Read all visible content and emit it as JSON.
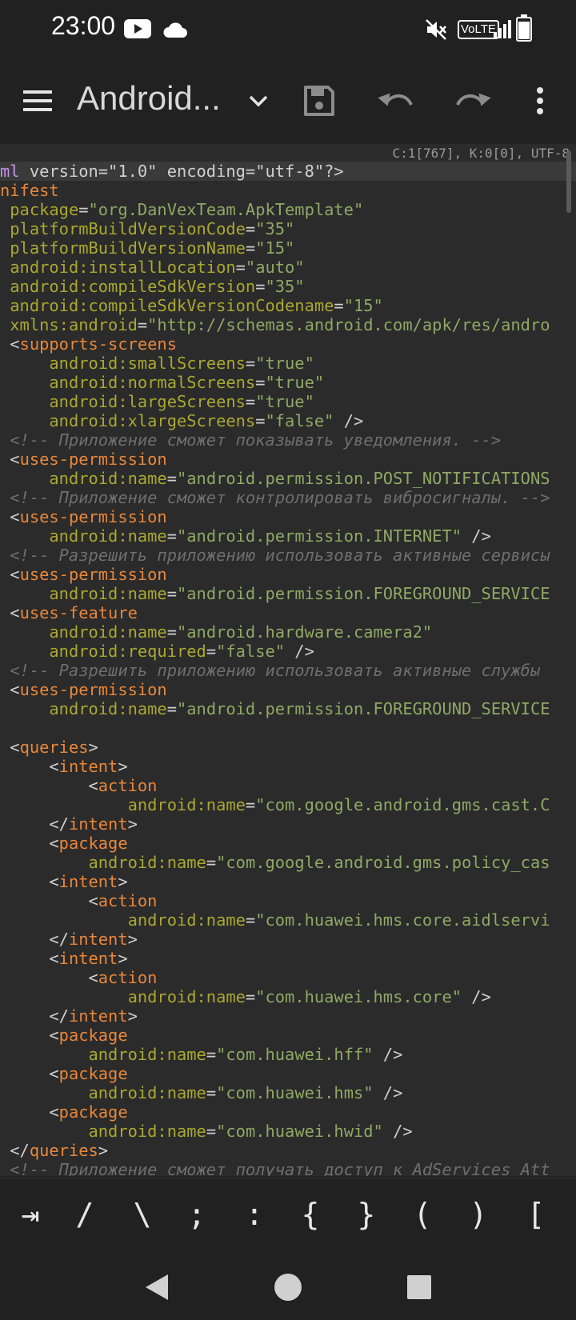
{
  "status_bar": {
    "time": "23:00",
    "icons": [
      "youtube-icon",
      "cloud-icon",
      "mute-icon",
      "volte-badge",
      "signal-icon",
      "battery-icon"
    ],
    "volte_label": "VoLTE"
  },
  "toolbar": {
    "title": "Android...",
    "icons": [
      "menu-icon",
      "dropdown-chevron-icon",
      "save-icon",
      "undo-icon",
      "redo-icon",
      "more-vert-icon"
    ]
  },
  "editor": {
    "cursor_info": "C:1[767], K:0[0], UTF-8",
    "lines": [
      [
        [
          "pi",
          "ml"
        ],
        [
          "txt",
          " version=\"1.0\" encoding=\"utf-8\"?>"
        ]
      ],
      [
        [
          "tag",
          "nifest"
        ]
      ],
      [
        [
          "txt",
          " "
        ],
        [
          "attr",
          "package"
        ],
        [
          "pun",
          "="
        ],
        [
          "val",
          "\"org.DanVexTeam.ApkTemplate\""
        ]
      ],
      [
        [
          "txt",
          " "
        ],
        [
          "attr",
          "platformBuildVersionCode"
        ],
        [
          "pun",
          "="
        ],
        [
          "val",
          "\"35\""
        ]
      ],
      [
        [
          "txt",
          " "
        ],
        [
          "attr",
          "platformBuildVersionName"
        ],
        [
          "pun",
          "="
        ],
        [
          "val",
          "\"15\""
        ]
      ],
      [
        [
          "txt",
          " "
        ],
        [
          "attr",
          "android:installLocation"
        ],
        [
          "pun",
          "="
        ],
        [
          "val",
          "\"auto\""
        ]
      ],
      [
        [
          "txt",
          " "
        ],
        [
          "attr",
          "android:compileSdkVersion"
        ],
        [
          "pun",
          "="
        ],
        [
          "val",
          "\"35\""
        ]
      ],
      [
        [
          "txt",
          " "
        ],
        [
          "attr",
          "android:compileSdkVersionCodename"
        ],
        [
          "pun",
          "="
        ],
        [
          "val",
          "\"15\""
        ]
      ],
      [
        [
          "txt",
          " "
        ],
        [
          "attr",
          "xmlns:android"
        ],
        [
          "pun",
          "="
        ],
        [
          "val",
          "\"http://schemas.android.com/apk/res/andro"
        ]
      ],
      [
        [
          "pun",
          " <"
        ],
        [
          "tag",
          "supports-screens"
        ]
      ],
      [
        [
          "txt",
          "     "
        ],
        [
          "attr",
          "android:smallScreens"
        ],
        [
          "pun",
          "="
        ],
        [
          "val",
          "\"true\""
        ]
      ],
      [
        [
          "txt",
          "     "
        ],
        [
          "attr",
          "android:normalScreens"
        ],
        [
          "pun",
          "="
        ],
        [
          "val",
          "\"true\""
        ]
      ],
      [
        [
          "txt",
          "     "
        ],
        [
          "attr",
          "android:largeScreens"
        ],
        [
          "pun",
          "="
        ],
        [
          "val",
          "\"true\""
        ]
      ],
      [
        [
          "txt",
          "     "
        ],
        [
          "attr",
          "android:xlargeScreens"
        ],
        [
          "pun",
          "="
        ],
        [
          "val",
          "\"false\""
        ],
        [
          "pun",
          " />"
        ]
      ],
      [
        [
          "cmt",
          " <!-- Приложение сможет показывать уведомления. -->"
        ]
      ],
      [
        [
          "pun",
          " <"
        ],
        [
          "tag",
          "uses-permission"
        ]
      ],
      [
        [
          "txt",
          "     "
        ],
        [
          "attr",
          "android:name"
        ],
        [
          "pun",
          "="
        ],
        [
          "val",
          "\"android.permission.POST_NOTIFICATIONS"
        ]
      ],
      [
        [
          "cmt",
          " <!-- Приложение сможет контролировать вибросигналы. -->"
        ]
      ],
      [
        [
          "pun",
          " <"
        ],
        [
          "tag",
          "uses-permission"
        ]
      ],
      [
        [
          "txt",
          "     "
        ],
        [
          "attr",
          "android:name"
        ],
        [
          "pun",
          "="
        ],
        [
          "val",
          "\"android.permission.INTERNET\""
        ],
        [
          "pun",
          " />"
        ]
      ],
      [
        [
          "cmt",
          " <!-- Разрешить приложению использовать активные сервисы"
        ]
      ],
      [
        [
          "pun",
          " <"
        ],
        [
          "tag",
          "uses-permission"
        ]
      ],
      [
        [
          "txt",
          "     "
        ],
        [
          "attr",
          "android:name"
        ],
        [
          "pun",
          "="
        ],
        [
          "val",
          "\"android.permission.FOREGROUND_SERVICE"
        ]
      ],
      [
        [
          "pun",
          " <"
        ],
        [
          "tag",
          "uses-feature"
        ]
      ],
      [
        [
          "txt",
          "     "
        ],
        [
          "attr",
          "android:name"
        ],
        [
          "pun",
          "="
        ],
        [
          "val",
          "\"android.hardware.camera2\""
        ]
      ],
      [
        [
          "txt",
          "     "
        ],
        [
          "attr",
          "android:required"
        ],
        [
          "pun",
          "="
        ],
        [
          "val",
          "\"false\""
        ],
        [
          "pun",
          " />"
        ]
      ],
      [
        [
          "cmt",
          " <!-- Разрешить приложению использовать активные службы"
        ]
      ],
      [
        [
          "pun",
          " <"
        ],
        [
          "tag",
          "uses-permission"
        ]
      ],
      [
        [
          "txt",
          "     "
        ],
        [
          "attr",
          "android:name"
        ],
        [
          "pun",
          "="
        ],
        [
          "val",
          "\"android.permission.FOREGROUND_SERVICE"
        ]
      ],
      [
        [
          "txt",
          ""
        ]
      ],
      [
        [
          "pun",
          " <"
        ],
        [
          "tag",
          "queries"
        ],
        [
          "pun",
          ">"
        ]
      ],
      [
        [
          "pun",
          "     <"
        ],
        [
          "tag",
          "intent"
        ],
        [
          "pun",
          ">"
        ]
      ],
      [
        [
          "pun",
          "         <"
        ],
        [
          "tag",
          "action"
        ]
      ],
      [
        [
          "txt",
          "             "
        ],
        [
          "attr",
          "android:name"
        ],
        [
          "pun",
          "="
        ],
        [
          "val",
          "\"com.google.android.gms.cast.C"
        ]
      ],
      [
        [
          "pun",
          "     </"
        ],
        [
          "tag",
          "intent"
        ],
        [
          "pun",
          ">"
        ]
      ],
      [
        [
          "pun",
          "     <"
        ],
        [
          "tag",
          "package"
        ]
      ],
      [
        [
          "txt",
          "         "
        ],
        [
          "attr",
          "android:name"
        ],
        [
          "pun",
          "="
        ],
        [
          "val",
          "\"com.google.android.gms.policy_cas"
        ]
      ],
      [
        [
          "pun",
          "     <"
        ],
        [
          "tag",
          "intent"
        ],
        [
          "pun",
          ">"
        ]
      ],
      [
        [
          "pun",
          "         <"
        ],
        [
          "tag",
          "action"
        ]
      ],
      [
        [
          "txt",
          "             "
        ],
        [
          "attr",
          "android:name"
        ],
        [
          "pun",
          "="
        ],
        [
          "val",
          "\"com.huawei.hms.core.aidlservi"
        ]
      ],
      [
        [
          "pun",
          "     </"
        ],
        [
          "tag",
          "intent"
        ],
        [
          "pun",
          ">"
        ]
      ],
      [
        [
          "pun",
          "     <"
        ],
        [
          "tag",
          "intent"
        ],
        [
          "pun",
          ">"
        ]
      ],
      [
        [
          "pun",
          "         <"
        ],
        [
          "tag",
          "action"
        ]
      ],
      [
        [
          "txt",
          "             "
        ],
        [
          "attr",
          "android:name"
        ],
        [
          "pun",
          "="
        ],
        [
          "val",
          "\"com.huawei.hms.core\""
        ],
        [
          "pun",
          " />"
        ]
      ],
      [
        [
          "pun",
          "     </"
        ],
        [
          "tag",
          "intent"
        ],
        [
          "pun",
          ">"
        ]
      ],
      [
        [
          "pun",
          "     <"
        ],
        [
          "tag",
          "package"
        ]
      ],
      [
        [
          "txt",
          "         "
        ],
        [
          "attr",
          "android:name"
        ],
        [
          "pun",
          "="
        ],
        [
          "val",
          "\"com.huawei.hff\""
        ],
        [
          "pun",
          " />"
        ]
      ],
      [
        [
          "pun",
          "     <"
        ],
        [
          "tag",
          "package"
        ]
      ],
      [
        [
          "txt",
          "         "
        ],
        [
          "attr",
          "android:name"
        ],
        [
          "pun",
          "="
        ],
        [
          "val",
          "\"com.huawei.hms\""
        ],
        [
          "pun",
          " />"
        ]
      ],
      [
        [
          "pun",
          "     <"
        ],
        [
          "tag",
          "package"
        ]
      ],
      [
        [
          "txt",
          "         "
        ],
        [
          "attr",
          "android:name"
        ],
        [
          "pun",
          "="
        ],
        [
          "val",
          "\"com.huawei.hwid\""
        ],
        [
          "pun",
          " />"
        ]
      ],
      [
        [
          "pun",
          " </"
        ],
        [
          "tag",
          "queries"
        ],
        [
          "pun",
          ">"
        ]
      ],
      [
        [
          "cmt",
          " <!-- Приложение сможет получать доступ к AdServices Att"
        ]
      ]
    ]
  },
  "extra_keys": [
    "⇥",
    "/",
    "\\",
    ";",
    ":",
    "{",
    "}",
    "(",
    ")",
    "["
  ],
  "nav_bar": {
    "icons": [
      "back-icon",
      "home-icon",
      "recents-icon"
    ]
  }
}
